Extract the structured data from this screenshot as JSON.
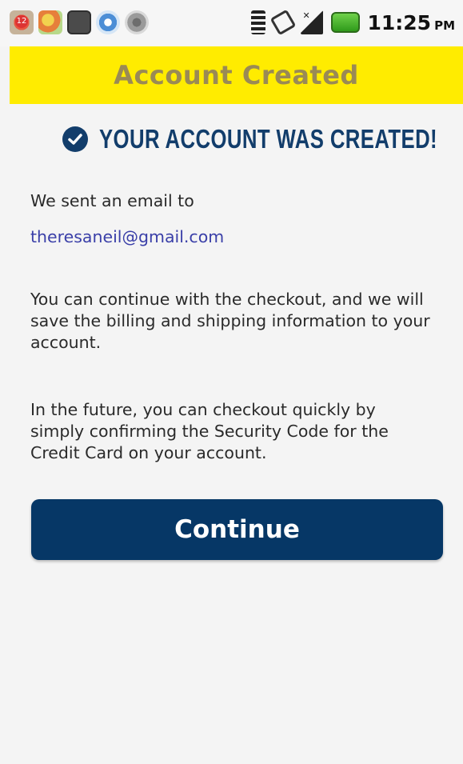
{
  "status_bar": {
    "time": "11:25",
    "ampm": "PM",
    "notification_icons": [
      "app-badge-icon",
      "weather-icon",
      "media-icon",
      "sync-icon",
      "voicemail-icon"
    ],
    "notification_badge": "12",
    "system_icons": [
      "wifi-icon",
      "vibrate-icon",
      "signal-icon",
      "battery-icon"
    ]
  },
  "title_bar": {
    "title": "Account Created",
    "background_color": "#ffec00",
    "title_color": "#9a8a55"
  },
  "content": {
    "heading": "YOUR ACCOUNT WAS CREATED!",
    "heading_icon": "check-circle-icon",
    "sent_text": "We sent an email to",
    "email": "theresaneil@gmail.com",
    "continue_text": "You can continue with the checkout, and we will save the billing and shipping information to your account.",
    "future_text": "In the future, you can checkout quickly by simply confirming the Security Code for the Credit Card on your account."
  },
  "continue_button": {
    "label": "Continue",
    "color": "#063766"
  },
  "colors": {
    "accent": "#123d6b",
    "link": "#3a3fa8",
    "background": "#f4f4f4"
  }
}
